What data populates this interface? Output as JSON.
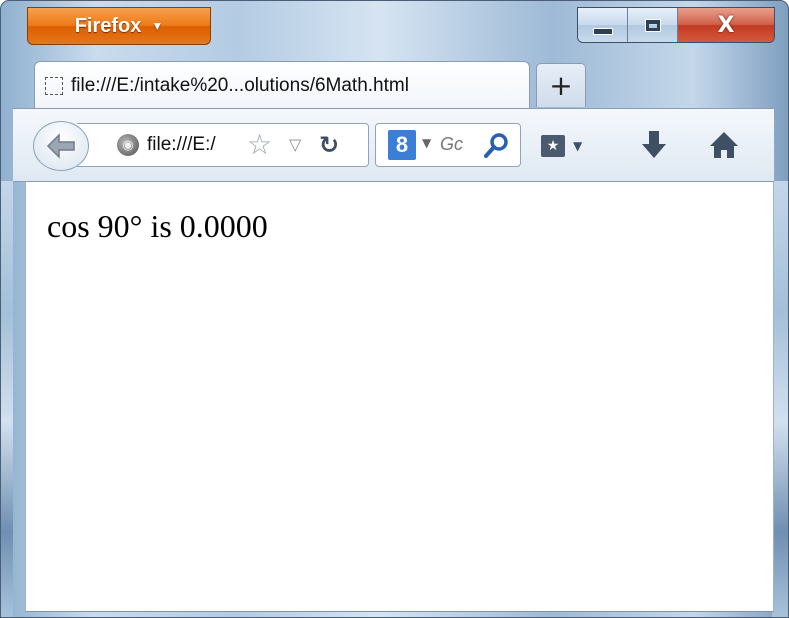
{
  "app": {
    "menu_button_label": "Firefox",
    "menu_button_caret": "▼"
  },
  "window_controls": {
    "minimize": "minimize",
    "maximize": "maximize",
    "close_glyph": "X"
  },
  "tabs": [
    {
      "title": "file:///E:/intake%20...olutions/6Math.html",
      "active": true
    }
  ],
  "new_tab_label": "+",
  "navbar": {
    "url": "file:///E:/",
    "search_engine_glyph": "8",
    "search_placeholder": "Gc",
    "icons": [
      "back-arrow-icon",
      "globe-icon",
      "star-icon",
      "dropdown-icon",
      "reload-icon",
      "google-icon",
      "search-icon",
      "bookmarks-icon",
      "download-icon",
      "home-icon"
    ]
  },
  "page": {
    "text": "cos 90° is 0.0000"
  },
  "colors": {
    "firefox_orange": "#e87817",
    "close_red": "#c7402a",
    "frame_blue": "#b3cbe3"
  }
}
